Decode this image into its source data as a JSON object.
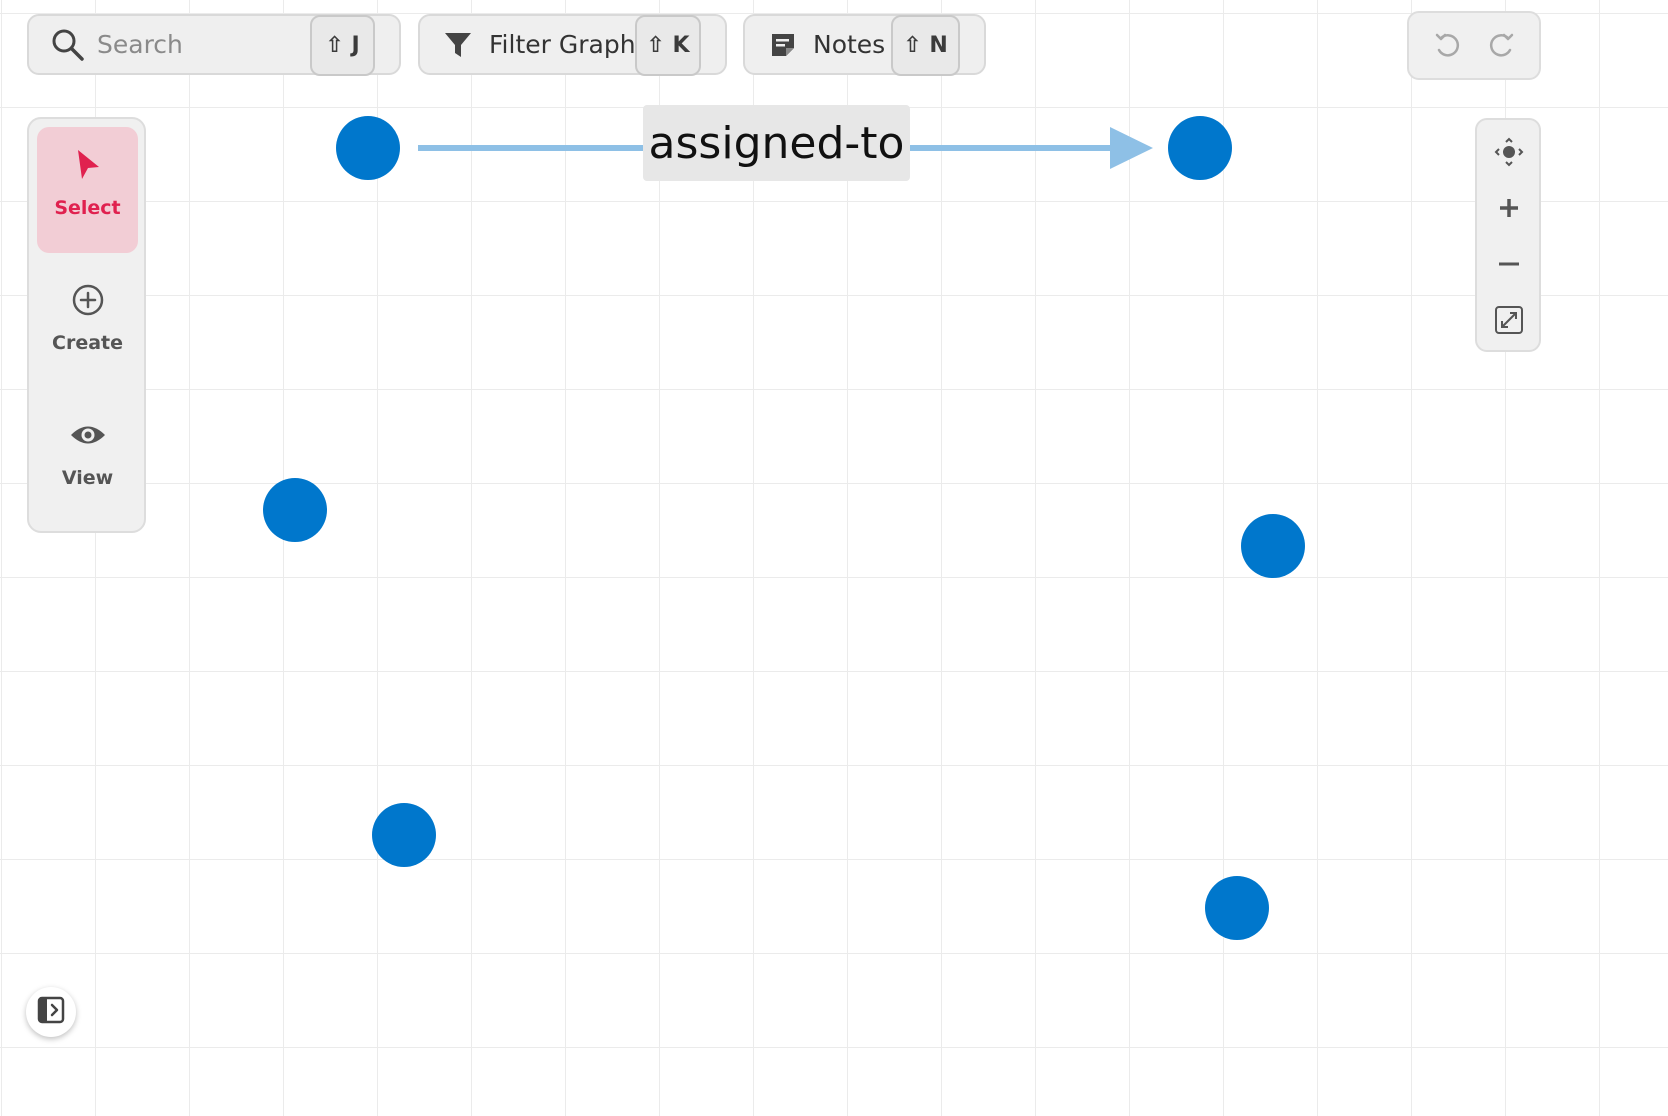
{
  "toolbar": {
    "search": {
      "placeholder": "Search",
      "shortcut": "⇧ J"
    },
    "filter": {
      "label": "Filter Graph",
      "shortcut": "⇧ K"
    },
    "notes": {
      "label": "Notes",
      "shortcut": "⇧ N"
    }
  },
  "tools": [
    {
      "label": "Select",
      "icon": "cursor-icon",
      "active": true
    },
    {
      "label": "Create",
      "icon": "plus-circle-icon",
      "active": false
    },
    {
      "label": "View",
      "icon": "eye-icon",
      "active": false
    }
  ],
  "zoom_controls": [
    "center-icon",
    "zoom-in-icon",
    "zoom-out-icon",
    "fit-screen-icon"
  ],
  "history": [
    "undo-icon",
    "redo-icon"
  ],
  "graph": {
    "node_color": "#0077cc",
    "edge_color": "#8ec0e6",
    "edge_label": "assigned-to"
  },
  "colors": {
    "accent": "#e0214f",
    "accent_bg": "#f2cdd5"
  }
}
